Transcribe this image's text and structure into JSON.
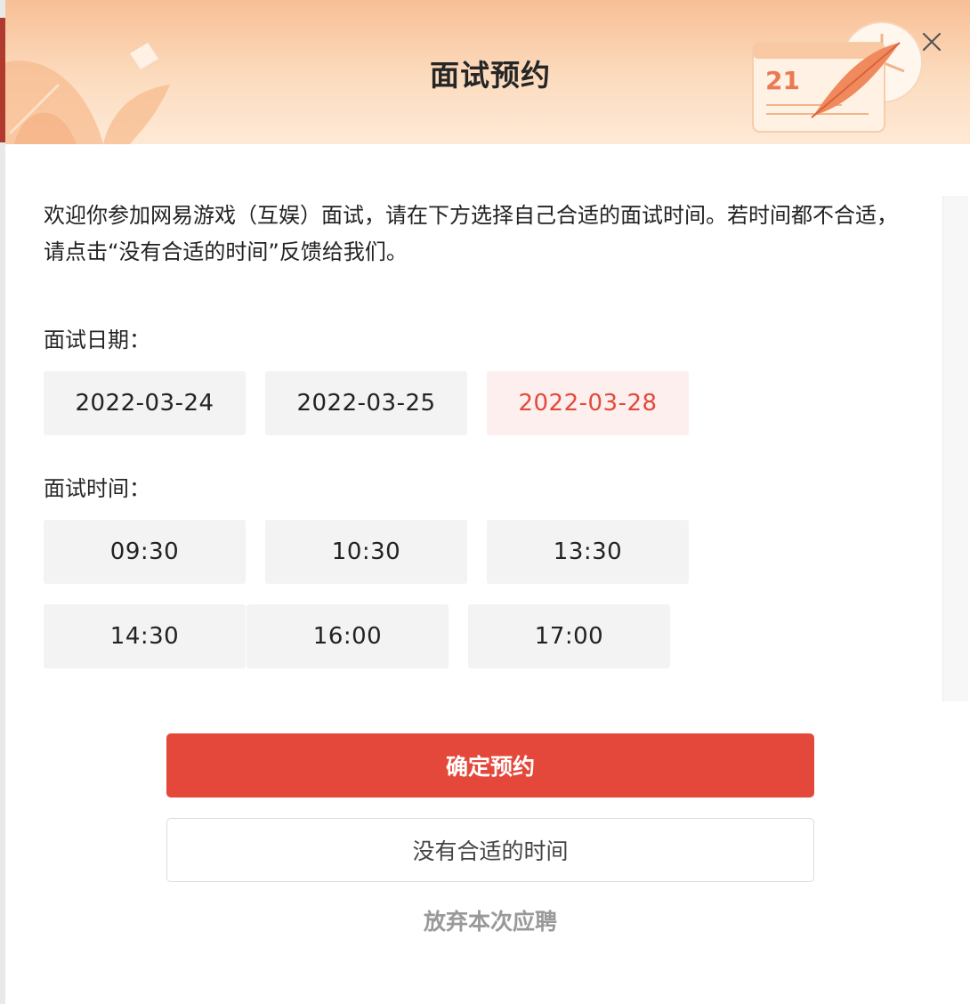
{
  "modal": {
    "title": "面试预约",
    "intro": "欢迎你参加网易游戏（互娱）面试，请在下方选择自己合适的面试时间。若时间都不合适，请点击“没有合适的时间”反馈给我们。",
    "calendar_day": "21"
  },
  "date_section": {
    "label": "面试日期：",
    "options": [
      "2022-03-24",
      "2022-03-25",
      "2022-03-28"
    ],
    "selected": "2022-03-28"
  },
  "time_section": {
    "label": "面试时间：",
    "options": [
      "09:30",
      "10:30",
      "13:30",
      "14:30",
      "16:00",
      "17:00"
    ]
  },
  "buttons": {
    "confirm": "确定预约",
    "no_suitable_time": "没有合适的时间",
    "give_up": "放弃本次应聘"
  },
  "colors": {
    "accent": "#e4483a",
    "selected_text": "#e24a3b",
    "selected_bg": "#fcefee",
    "header_top": "#f8bf95",
    "header_bottom": "#fee9d6"
  },
  "icons": {
    "close": "close-icon",
    "calendar": "calendar-illustration",
    "feather": "feather-quill-icon",
    "clock": "clock-illustration",
    "leaf": "leaf-decoration"
  }
}
